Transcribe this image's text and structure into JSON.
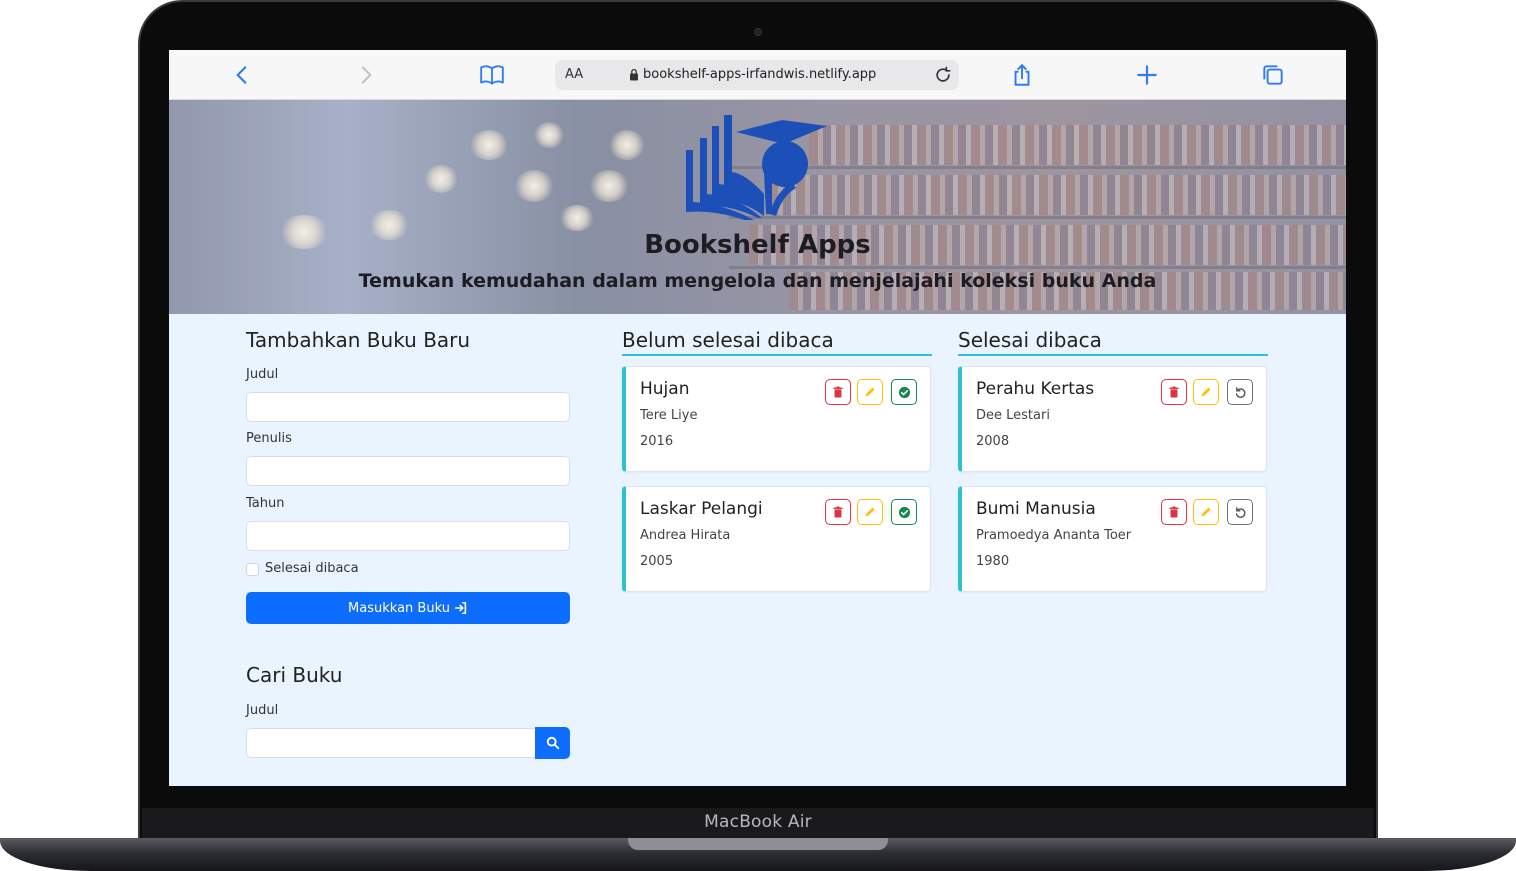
{
  "device": {
    "label": "MacBook Air"
  },
  "browser": {
    "aa_label": "AA",
    "url": "bookshelf-apps-irfandwis.netlify.app",
    "icons": [
      "back-icon",
      "forward-icon",
      "bookmarks-icon",
      "lock-icon",
      "reload-icon",
      "share-icon",
      "new-tab-icon",
      "tabs-icon"
    ]
  },
  "hero": {
    "title": "Bookshelf Apps",
    "subtitle": "Temukan kemudahan dalam mengelola dan menjelajahi koleksi buku Anda"
  },
  "add_form": {
    "heading": "Tambahkan Buku Baru",
    "title_label": "Judul",
    "title_value": "",
    "author_label": "Penulis",
    "author_value": "",
    "year_label": "Tahun",
    "year_value": "",
    "complete_label": "Selesai dibaca",
    "complete_checked": false,
    "submit_label": "Masukkan Buku"
  },
  "search": {
    "heading": "Cari Buku",
    "label": "Judul",
    "value": ""
  },
  "unread": {
    "heading": "Belum selesai dibaca",
    "books": [
      {
        "title": "Hujan",
        "author": "Tere Liye",
        "year": "2016"
      },
      {
        "title": "Laskar Pelangi",
        "author": "Andrea Hirata",
        "year": "2005"
      }
    ]
  },
  "read": {
    "heading": "Selesai dibaca",
    "books": [
      {
        "title": "Perahu Kertas",
        "author": "Dee Lestari",
        "year": "2008"
      },
      {
        "title": "Bumi Manusia",
        "author": "Pramoedya Ananta Toer",
        "year": "1980"
      }
    ]
  },
  "colors": {
    "primary": "#0d6efd",
    "accent": "#30bfd6",
    "danger": "#dc3545",
    "warning": "#ffc107",
    "success": "#198754",
    "secondary": "#6c757d",
    "logo": "#1d4fb8"
  }
}
